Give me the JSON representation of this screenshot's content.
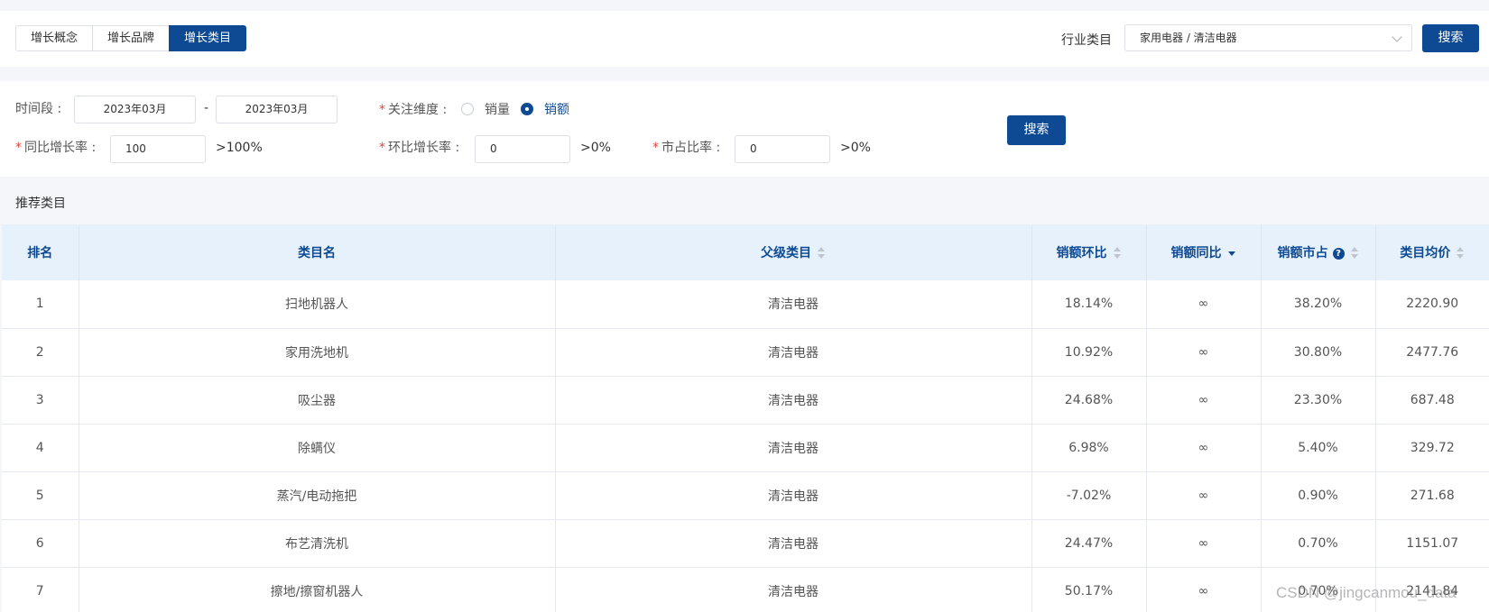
{
  "tabs": [
    {
      "label": "增长概念",
      "active": false
    },
    {
      "label": "增长品牌",
      "active": false
    },
    {
      "label": "增长类目",
      "active": true
    }
  ],
  "industry": {
    "label": "行业类目",
    "value": "家用电器 / 清洁电器"
  },
  "top_search_label": "搜索",
  "filter": {
    "period_label": "时间段 :",
    "period_start": "2023年03月",
    "period_sep": "-",
    "period_end": "2023年03月",
    "dimension_label": "关注维度 :",
    "dimension_options": [
      {
        "label": "销量",
        "selected": false
      },
      {
        "label": "销额",
        "selected": true
      }
    ],
    "yoy_label": "同比增长率 :",
    "yoy_value": "100",
    "yoy_hint": ">100%",
    "mom_label": "环比增长率 :",
    "mom_value": "0",
    "mom_hint": ">0%",
    "share_label": "市占比率 :",
    "share_value": "0",
    "share_hint": ">0%",
    "search_label": "搜索"
  },
  "section_title": "推荐类目",
  "table": {
    "columns": [
      "排名",
      "类目名",
      "父级类目",
      "销额环比",
      "销额同比",
      "销额市占",
      "类目均价"
    ],
    "rows": [
      {
        "rank": "1",
        "name": "扫地机器人",
        "parent": "清洁电器",
        "mom": "18.14%",
        "yoy": "∞",
        "share": "38.20%",
        "avg_price": "2220.90"
      },
      {
        "rank": "2",
        "name": "家用洗地机",
        "parent": "清洁电器",
        "mom": "10.92%",
        "yoy": "∞",
        "share": "30.80%",
        "avg_price": "2477.76"
      },
      {
        "rank": "3",
        "name": "吸尘器",
        "parent": "清洁电器",
        "mom": "24.68%",
        "yoy": "∞",
        "share": "23.30%",
        "avg_price": "687.48"
      },
      {
        "rank": "4",
        "name": "除螨仪",
        "parent": "清洁电器",
        "mom": "6.98%",
        "yoy": "∞",
        "share": "5.40%",
        "avg_price": "329.72"
      },
      {
        "rank": "5",
        "name": "蒸汽/电动拖把",
        "parent": "清洁电器",
        "mom": "-7.02%",
        "yoy": "∞",
        "share": "0.90%",
        "avg_price": "271.68"
      },
      {
        "rank": "6",
        "name": "布艺清洗机",
        "parent": "清洁电器",
        "mom": "24.47%",
        "yoy": "∞",
        "share": "0.70%",
        "avg_price": "1151.07"
      },
      {
        "rank": "7",
        "name": "擦地/擦窗机器人",
        "parent": "清洁电器",
        "mom": "50.17%",
        "yoy": "∞",
        "share": "0.70%",
        "avg_price": "2141.84"
      }
    ]
  },
  "watermark": "CSDN @jingcanmou_data",
  "colors": {
    "primary": "#0d4a93",
    "header_bg": "#e6f1fb",
    "rank1": "#f4b400",
    "rank2": "#9aa0a6",
    "rank3": "#b8862b"
  }
}
